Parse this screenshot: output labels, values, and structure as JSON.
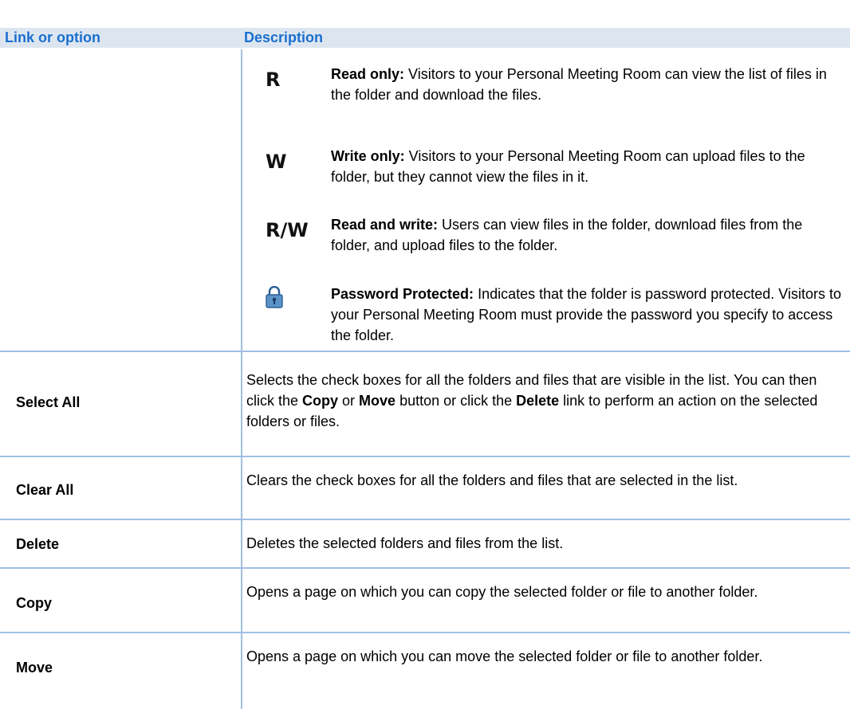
{
  "header": {
    "col1": "Link or option",
    "col2": "Description"
  },
  "permissions": [
    {
      "code": "R",
      "title": "Read only:",
      "text": " Visitors to your Personal Meeting Room can view the list of files in the folder and download the files."
    },
    {
      "code": "W",
      "title": "Write only:",
      "text": " Visitors to your Personal Meeting Room can upload files to the folder, but they cannot view the files in it."
    },
    {
      "code": "R/W",
      "title": "Read and write:",
      "text": " Users can view files in the folder, download files from the folder, and upload files to the folder."
    },
    {
      "icon": "lock-icon",
      "title": "Password Protected:",
      "text": " Indicates that the folder is password protected. Visitors to your Personal Meeting Room must provide the password you specify to access the folder."
    }
  ],
  "rows": [
    {
      "label": "Select All",
      "desc_parts": [
        "Selects the check boxes for all the folders and files that are visible in the list. You can then click the ",
        "Copy",
        " or ",
        "Move",
        " button or click the ",
        "Delete",
        " link to perform an action on the selected folders or files."
      ]
    },
    {
      "label": "Clear All",
      "desc": "Clears the check boxes for all the folders and files that are selected in the list."
    },
    {
      "label": "Delete",
      "desc": "Deletes the selected folders and files from the list."
    },
    {
      "label": "Copy",
      "desc": "Opens a page on which you can copy the selected folder or file to another folder."
    },
    {
      "label": "Move",
      "desc": "Opens a page on which you can move the selected folder or file to another folder."
    }
  ]
}
